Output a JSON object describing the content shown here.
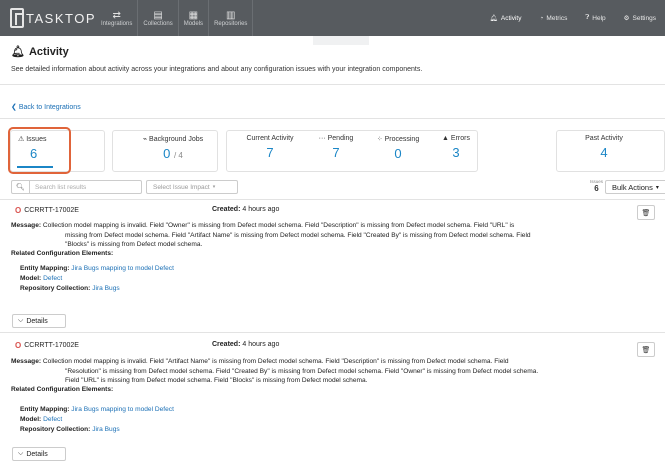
{
  "app": {
    "logo_text": "TASKTOP"
  },
  "nav": [
    {
      "label": "Integrations",
      "icon": "⇄"
    },
    {
      "label": "Collections",
      "icon": "▤"
    },
    {
      "label": "Models",
      "icon": "▦"
    },
    {
      "label": "Repositories",
      "icon": "▥"
    }
  ],
  "right_nav": {
    "activity": "Activity",
    "metrics": "Metrics",
    "help": "Help",
    "settings": "Settings"
  },
  "page": {
    "title": "Activity",
    "subtitle": "See detailed information about activity across your integrations and about any configuration issues with your integration components.",
    "back_link": "Back to Integrations"
  },
  "stats": {
    "issues": {
      "label": "Issues",
      "value": "6"
    },
    "background_jobs": {
      "label": "Background Jobs",
      "value": "0",
      "total": "/ 4"
    },
    "current_activity": {
      "label": "Current Activity",
      "value": "7"
    },
    "pending": {
      "label": "Pending",
      "value": "7"
    },
    "processing": {
      "label": "Processing",
      "value": "0"
    },
    "errors": {
      "label": "Errors",
      "value": "3"
    },
    "past_activity": {
      "label": "Past Activity",
      "value": "4"
    }
  },
  "toolbar": {
    "search_placeholder": "Search list results",
    "impact_placeholder": "Select Issue Impact",
    "issues_count_label": "Issues",
    "issues_count": "6",
    "bulk_actions": "Bulk Actions"
  },
  "issues": [
    {
      "id": "CCRRTT-17002E",
      "created_label": "Created:",
      "created_value": "4 hours ago",
      "message_label": "Message:",
      "message_line1": "Collection model mapping is invalid. Field \"Owner\" is missing from Defect model schema. Field \"Description\" is missing from Defect model schema. Field \"URL\" is",
      "message_line2": "missing from Defect model schema. Field \"Artifact Name\" is missing from Defect model schema. Field \"Created By\" is missing from Defect model schema. Field",
      "message_line3": "\"Blocks\" is missing from Defect model schema.",
      "related_label": "Related Configuration Elements:",
      "entity_mapping_label": "Entity Mapping:",
      "entity_mapping_value": "Jira Bugs mapping to model Defect",
      "model_label": "Model:",
      "model_value": "Defect",
      "repo_collection_label": "Repository Collection:",
      "repo_collection_value": "Jira Bugs",
      "details_label": "Details"
    },
    {
      "id": "CCRRTT-17002E",
      "created_label": "Created:",
      "created_value": "4 hours ago",
      "message_label": "Message:",
      "message_line1": "Collection model mapping is invalid. Field \"Artifact Name\" is missing from Defect model schema. Field \"Description\" is missing from Defect model schema. Field",
      "message_line2": "\"Resolution\" is missing from Defect model schema. Field \"Created By\" is missing from Defect model schema. Field \"Owner\" is missing from Defect model schema.",
      "message_line3": "Field \"URL\" is missing from Defect model schema. Field \"Blocks\" is missing from Defect model schema.",
      "related_label": "Related Configuration Elements:",
      "entity_mapping_label": "Entity Mapping:",
      "entity_mapping_value": "Jira Bugs mapping to model Defect",
      "model_label": "Model:",
      "model_value": "Defect",
      "repo_collection_label": "Repository Collection:",
      "repo_collection_value": "Jira Bugs",
      "details_label": "Details"
    }
  ],
  "colors": {
    "accent": "#1b86c6",
    "highlight": "#e0643a",
    "topbar": "#575b5f",
    "error": "#d9534f",
    "link": "#1a6fb5"
  }
}
